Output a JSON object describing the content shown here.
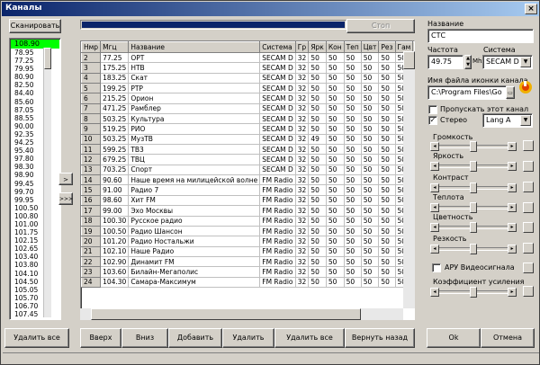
{
  "window": {
    "title": "Каналы",
    "close_label": "×"
  },
  "top": {
    "scan_label": "Сканировать",
    "stop_label": "Стоп",
    "progress_fraction": 1.0
  },
  "freq_list": {
    "selected": "108.90",
    "items": [
      "78.95",
      "77.25",
      "79.95",
      "80.90",
      "82.50",
      "84.40",
      "85.60",
      "87.05",
      "88.55",
      "90.00",
      "92.35",
      "94.25",
      "95.40",
      "97.80",
      "98.30",
      "98.90",
      "99.45",
      "99.70",
      "99.95",
      "100.50",
      "100.80",
      "101.00",
      "101.75",
      "102.15",
      "102.65",
      "103.40",
      "103.80",
      "104.10",
      "104.50",
      "105.05",
      "105.70",
      "106.70",
      "107.45"
    ]
  },
  "move_buttons": {
    "move_one": ">",
    "move_all": ">>>"
  },
  "table": {
    "headers": [
      "Нмр",
      "Мгц",
      "Название",
      "Система",
      "Гр",
      "Ярк",
      "Кон",
      "Теп",
      "Цвт",
      "Рез",
      "Гам",
      "ББ",
      "Ков"
    ],
    "rows": [
      [
        "2",
        "77.25",
        "ОРТ",
        "SECAM D",
        "32",
        "50",
        "50",
        "50",
        "50",
        "50",
        "50",
        "50",
        "50"
      ],
      [
        "3",
        "175.25",
        "НТВ",
        "SECAM D",
        "32",
        "50",
        "50",
        "50",
        "50",
        "50",
        "50",
        "50",
        "50"
      ],
      [
        "4",
        "183.25",
        "Скат",
        "SECAM D",
        "32",
        "50",
        "50",
        "50",
        "50",
        "50",
        "50",
        "50",
        "50"
      ],
      [
        "5",
        "199.25",
        "РТР",
        "SECAM D",
        "32",
        "50",
        "50",
        "50",
        "50",
        "50",
        "50",
        "50",
        "50"
      ],
      [
        "6",
        "215.25",
        "Орион",
        "SECAM D",
        "32",
        "50",
        "50",
        "50",
        "50",
        "50",
        "50",
        "50",
        "50"
      ],
      [
        "7",
        "471.25",
        "Рамблер",
        "SECAM D",
        "32",
        "50",
        "50",
        "50",
        "50",
        "50",
        "50",
        "50",
        "50"
      ],
      [
        "8",
        "503.25",
        "Культура",
        "SECAM D",
        "32",
        "50",
        "50",
        "50",
        "50",
        "50",
        "50",
        "50",
        "50"
      ],
      [
        "9",
        "519.25",
        "РИО",
        "SECAM D",
        "32",
        "50",
        "50",
        "50",
        "50",
        "50",
        "50",
        "50",
        "50"
      ],
      [
        "10",
        "503.25",
        "МузТВ",
        "SECAM D",
        "32",
        "49",
        "50",
        "50",
        "50",
        "50",
        "50",
        "50",
        "50"
      ],
      [
        "11",
        "599.25",
        "ТВ3",
        "SECAM D",
        "32",
        "50",
        "50",
        "50",
        "50",
        "50",
        "50",
        "50",
        "50"
      ],
      [
        "12",
        "679.25",
        "ТВЦ",
        "SECAM D",
        "32",
        "50",
        "50",
        "50",
        "50",
        "50",
        "50",
        "50",
        "50"
      ],
      [
        "13",
        "703.25",
        "Спорт",
        "SECAM D",
        "32",
        "50",
        "50",
        "50",
        "50",
        "50",
        "50",
        "50",
        "50"
      ],
      [
        "14",
        "90.60",
        "Наше время на милицейской волне",
        "FM Radio",
        "32",
        "50",
        "50",
        "50",
        "50",
        "50",
        "50",
        "50",
        "50"
      ],
      [
        "15",
        "91.00",
        "Радио 7",
        "FM Radio",
        "32",
        "50",
        "50",
        "50",
        "50",
        "50",
        "50",
        "50",
        "50"
      ],
      [
        "16",
        "98.60",
        "Хит FM",
        "FM Radio",
        "32",
        "50",
        "50",
        "50",
        "50",
        "50",
        "50",
        "50",
        "50"
      ],
      [
        "17",
        "99.00",
        "Эхо Москвы",
        "FM Radio",
        "32",
        "50",
        "50",
        "50",
        "50",
        "50",
        "50",
        "50",
        "50"
      ],
      [
        "18",
        "100.30",
        "Русское радио",
        "FM Radio",
        "32",
        "50",
        "50",
        "50",
        "50",
        "50",
        "50",
        "50",
        "50"
      ],
      [
        "19",
        "100.50",
        "Радио Шансон",
        "FM Radio",
        "32",
        "50",
        "50",
        "50",
        "50",
        "50",
        "50",
        "50",
        "50"
      ],
      [
        "20",
        "101.20",
        "Радио Ностальжи",
        "FM Radio",
        "32",
        "50",
        "50",
        "50",
        "50",
        "50",
        "50",
        "50",
        "50"
      ],
      [
        "21",
        "102.10",
        "Наше Радио",
        "FM Radio",
        "32",
        "50",
        "50",
        "50",
        "50",
        "50",
        "50",
        "50",
        "50"
      ],
      [
        "22",
        "102.90",
        "Динамит FM",
        "FM Radio",
        "32",
        "50",
        "50",
        "50",
        "50",
        "50",
        "50",
        "50",
        "50"
      ],
      [
        "23",
        "103.60",
        "Билайн-Мегаполис",
        "FM Radio",
        "32",
        "50",
        "50",
        "50",
        "50",
        "50",
        "50",
        "50",
        "50"
      ],
      [
        "24",
        "104.30",
        "Самара-Максимум",
        "FM Radio",
        "32",
        "50",
        "50",
        "50",
        "50",
        "50",
        "50",
        "50",
        "50"
      ]
    ]
  },
  "props": {
    "name_label": "Название",
    "name_value": "СТС",
    "freq_label": "Частота",
    "freq_value": "49.75",
    "mhz_label": "Mhz",
    "system_label": "Система",
    "system_value": "SECAM D",
    "icon_label": "Имя файла иконки канала",
    "icon_path": "C:\\Program Files\\Go",
    "skip_label": "Пропускать этот канал",
    "stereo_label": "Стерео",
    "lang_value": "Lang A",
    "volume_label": "Громкость",
    "brightness_label": "Яркость",
    "contrast_label": "Контраст",
    "warmth_label": "Теплота",
    "color_label": "Цветность",
    "sharpness_label": "Резкость",
    "agc_label": "АРУ Видеосигнала",
    "gain_label": "Коэффициент усиления"
  },
  "bottom": {
    "delete_all_left": "Удалить все",
    "up": "Вверх",
    "down": "Вниз",
    "add": "Добавить",
    "delete": "Удалить",
    "delete_all": "Удалить все",
    "revert": "Вернуть назад",
    "ok": "Ok",
    "cancel": "Отмена"
  }
}
